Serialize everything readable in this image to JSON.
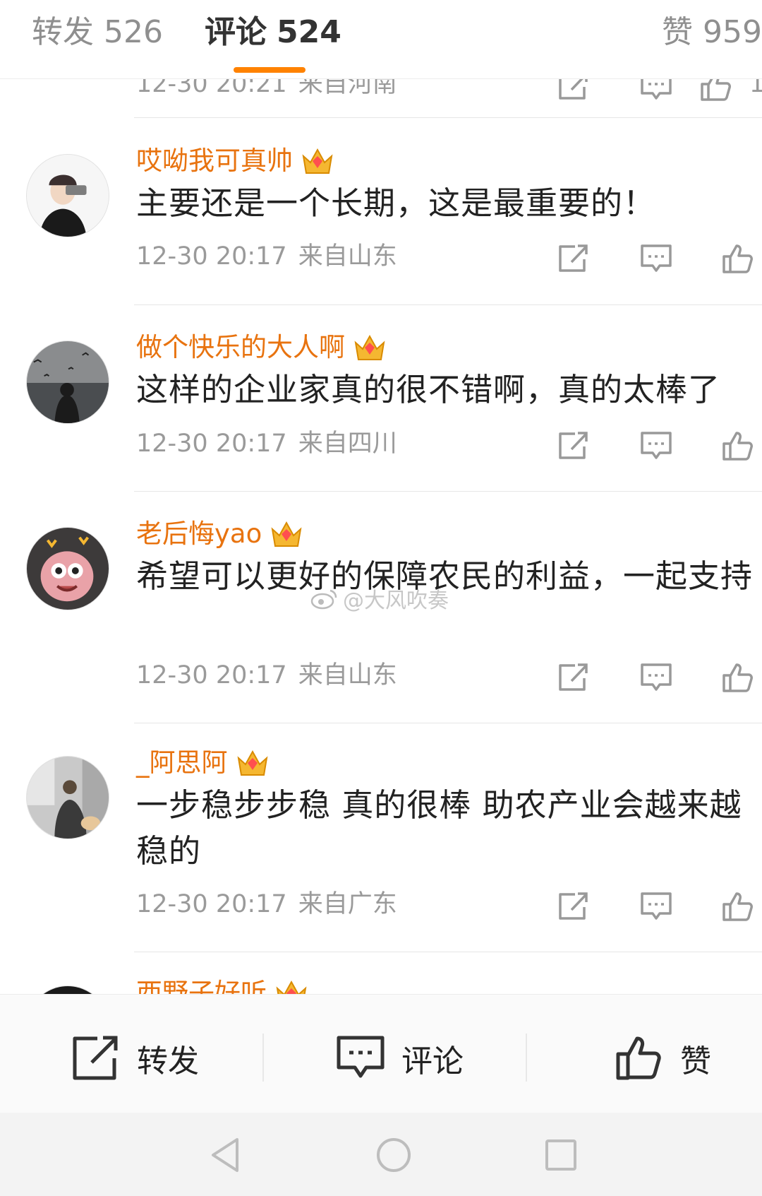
{
  "tabs": {
    "repost": {
      "label": "转发",
      "count": "526"
    },
    "comment": {
      "label": "评论",
      "count": "524"
    },
    "like": {
      "label": "赞",
      "count": "959"
    }
  },
  "colors": {
    "accent": "#ff8200",
    "username": "#e8730f",
    "meta": "#9a9a9a"
  },
  "partial_top": {
    "time": "12-30 20:21",
    "location": "来自河南",
    "like_count": "1"
  },
  "comments": [
    {
      "name": "哎呦我可真帅",
      "badge_level": "7",
      "text": "主要还是一个长期，这是最重要的！",
      "time": "12-30 20:17",
      "location": "来自山东"
    },
    {
      "name": "做个快乐的大人啊",
      "badge_level": "6",
      "text": "这样的企业家真的很不错啊，真的太棒了",
      "time": "12-30 20:17",
      "location": "来自四川"
    },
    {
      "name": "老后悔yao",
      "badge_level": "6",
      "text": "希望可以更好的保障农民的利益，一起支持",
      "time": "12-30 20:17",
      "location": "来自山东"
    },
    {
      "name": "_阿思阿",
      "badge_level": "4",
      "text": "一步稳步步稳 真的很棒 助农产业会越来越稳的",
      "time": "12-30 20:17",
      "location": "来自广东"
    },
    {
      "name": "西野子好听"
    }
  ],
  "watermark": "@大风吹奏",
  "actionbar": {
    "repost": "转发",
    "comment": "评论",
    "like": "赞"
  },
  "icons": {
    "share": "share-icon",
    "reply": "comment-icon",
    "like": "thumbs-up-icon",
    "badge": "crown-badge-icon",
    "back": "back-triangle-icon",
    "home": "home-circle-icon",
    "recent": "recent-square-icon"
  }
}
